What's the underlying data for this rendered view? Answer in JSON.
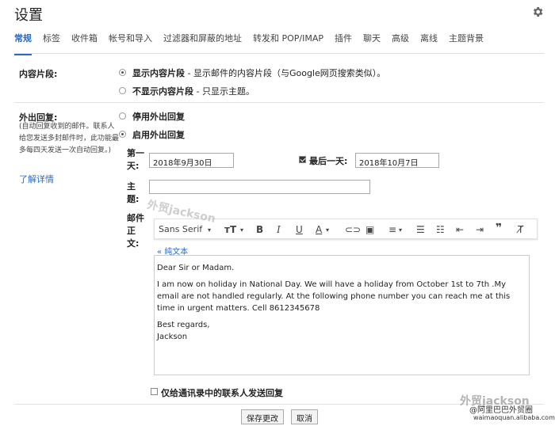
{
  "page": {
    "title": "设置"
  },
  "tabs": [
    "常规",
    "标签",
    "收件箱",
    "帐号和导入",
    "过滤器和屏蔽的地址",
    "转发和 POP/IMAP",
    "插件",
    "聊天",
    "高级",
    "离线",
    "主题背景"
  ],
  "snippets": {
    "label": "内容片段:",
    "opt1_bold": "显示内容片段",
    "opt1_rest": " - 显示邮件的内容片段（与Google网页搜索类似）。",
    "opt2_bold": "不显示内容片段",
    "opt2_rest": " - 只显示主题。"
  },
  "vacation": {
    "label": "外出回复:",
    "note": "(自动回复收到的邮件。联系人给您发送多封邮件时，此功能最多每四天发送一次自动回复。)",
    "learn_more": "了解详情",
    "off_label": "停用外出回复",
    "on_label": "启用外出回复",
    "first_day_label": "第一天:",
    "first_day": "2018年9月30日",
    "last_day_label": "最后一天:",
    "last_day": "2018年10月7日",
    "subject_label": "主题:",
    "body_label": "邮件正文:",
    "font": "Sans Serif",
    "plain_text": "« 纯文本",
    "message": {
      "p1": "Dear Sir or Madam.",
      "p2": "I am now on holiday in National Day. We will have a holiday from October 1st to 7th .My email are not handled regularly. At the following phone number you can reach me at this time in urgent matters. Cell 8612345678",
      "p3a": "Best regards,",
      "p3b": "Jackson"
    },
    "contacts_only": "仅给通讯录中的联系人发送回复"
  },
  "buttons": {
    "save": "保存更改",
    "cancel": "取消"
  },
  "watermarks": {
    "center": "外贸jackson",
    "br1": "外贸jackson",
    "br2": "@阿里巴巴外贸圈",
    "br3": "waimaoquan.alibaba.com"
  }
}
